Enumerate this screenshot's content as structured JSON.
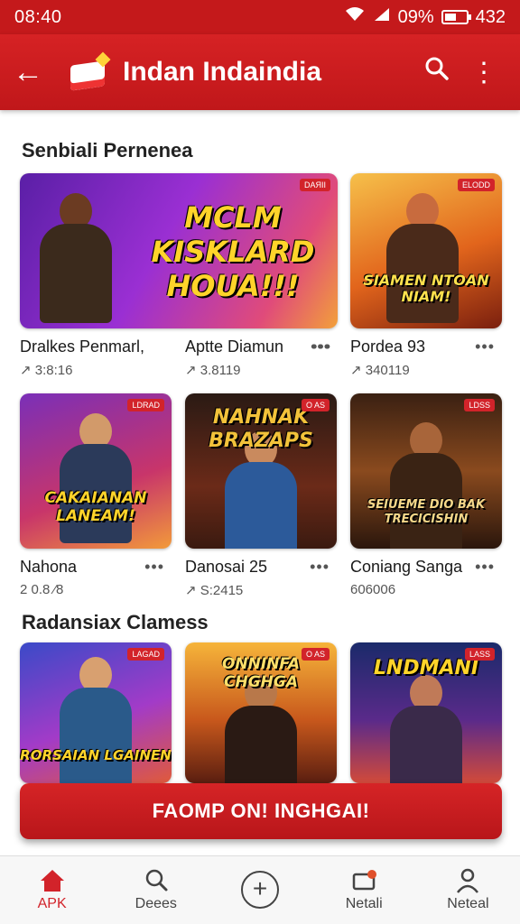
{
  "status": {
    "time": "08:40",
    "battery": "09%",
    "extra": "432"
  },
  "app_bar": {
    "back_icon": "←",
    "title": "Indan Indaindia",
    "search_icon": "⌕",
    "more_icon": "⋮"
  },
  "sections": [
    {
      "title": "Senbiali Pernenea"
    },
    {
      "title": "Radansiax Clamess"
    }
  ],
  "cards": [
    {
      "banner": "MCLM KISKLARD HOUA!!!",
      "badge": "DAЯII",
      "name": "Dralkes Penmarl,",
      "sub": "↗ 3:8:16",
      "more": "•••"
    },
    {
      "banner": "SIAMEN NTOAN NIAM!",
      "badge": "ELODD",
      "name": "Aptte Diamun",
      "sub": "↗ 3.8119",
      "more": "•••"
    },
    {
      "banner": "",
      "badge": "ELODD",
      "name": "Pordea 93",
      "sub": "↗ 340119",
      "more": "•••"
    },
    {
      "banner": "CAKAIANAN LANEAM!",
      "badge": "LDRAD",
      "name": "Nahona",
      "sub": "2 0.8 ⁄8",
      "more": "•••"
    },
    {
      "banner": "NAHNAK BRAZAPS",
      "badge": "O AS",
      "name": "Danosai 25",
      "sub": "↗ S:2415",
      "more": "•••"
    },
    {
      "banner": "SEIUEME DIO BAK TRECICISHIN",
      "badge": "LDSS",
      "name": "Coniang Sanga",
      "sub": "606006",
      "more": "•••"
    },
    {
      "banner": "RORSAIAN LGAINEN",
      "badge": "LAGAD",
      "name": "",
      "sub": "",
      "more": ""
    },
    {
      "banner": "ONNINFA CHGHGA",
      "badge": "O AS",
      "name": "",
      "sub": "",
      "more": ""
    },
    {
      "banner": "LNDMANI",
      "badge": "LASS",
      "name": "",
      "sub": "",
      "more": ""
    }
  ],
  "install_button": "FAOMP ON! INGHGAI!",
  "nav": [
    {
      "label": "APK",
      "icon": "home-icon"
    },
    {
      "label": "Deees",
      "icon": "search-icon"
    },
    {
      "label": "",
      "icon": "add-icon"
    },
    {
      "label": "Netali",
      "icon": "notification-icon"
    },
    {
      "label": "Neteal",
      "icon": "profile-icon"
    }
  ],
  "colors": {
    "brand": "#c4191b",
    "accent": "#d2232a"
  }
}
